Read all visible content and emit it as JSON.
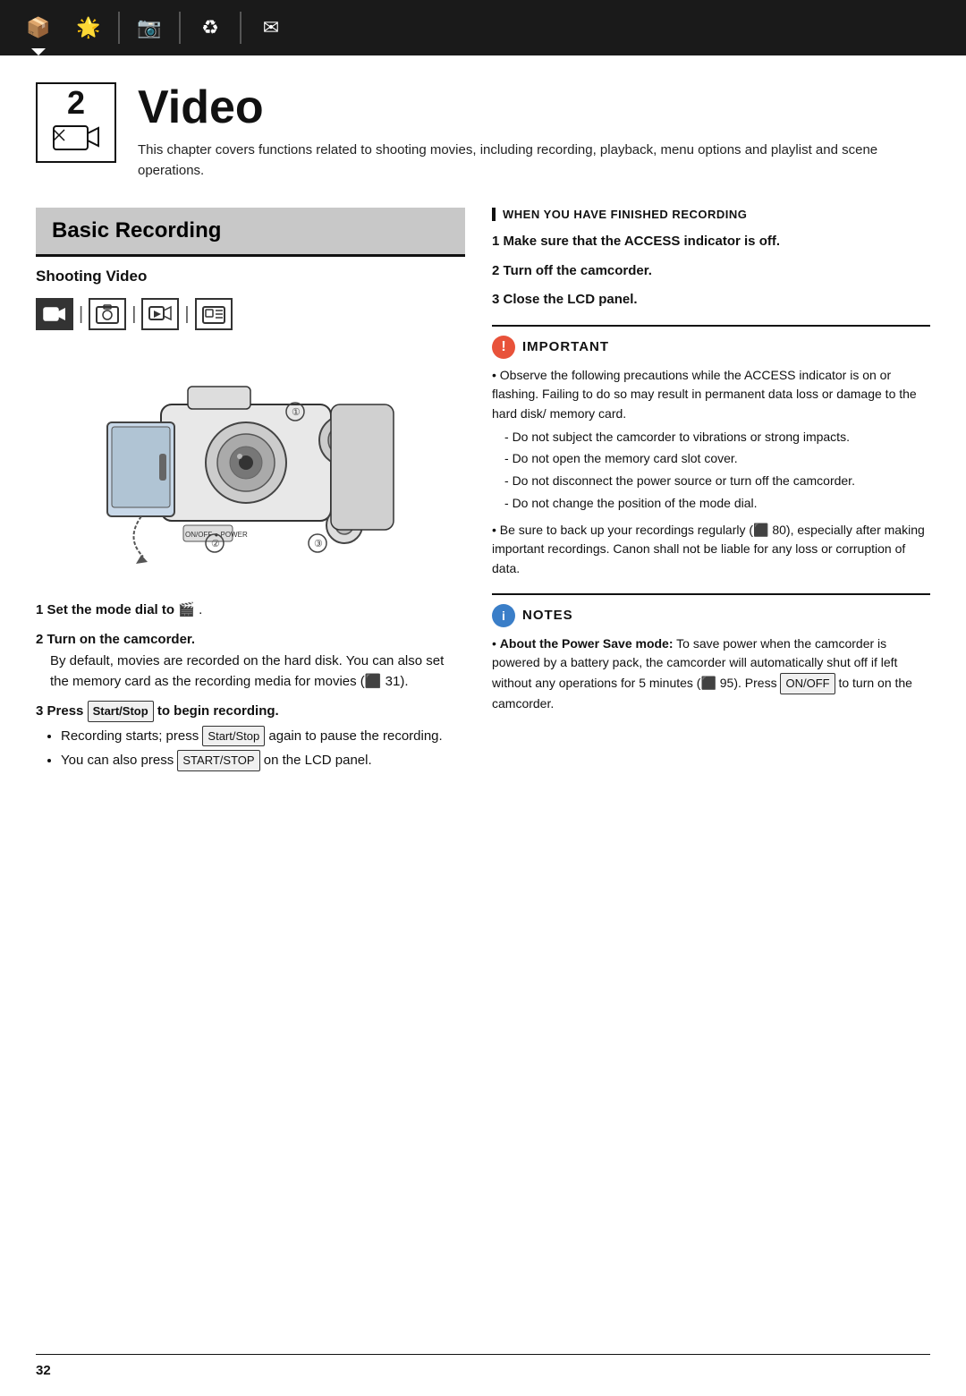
{
  "topbar": {
    "icons": [
      {
        "name": "box-icon",
        "symbol": "📦",
        "active": false
      },
      {
        "name": "star-icon",
        "symbol": "★",
        "active": true
      },
      {
        "name": "camera-icon",
        "symbol": "📷",
        "active": false
      },
      {
        "name": "recycle-icon",
        "symbol": "♻",
        "active": false
      },
      {
        "name": "envelope-icon",
        "symbol": "✉",
        "active": false
      }
    ]
  },
  "chapter": {
    "number": "2",
    "title": "Video",
    "description": "This chapter covers functions related to shooting movies, including recording, playback, menu options and playlist and scene operations."
  },
  "section": {
    "heading": "Basic Recording",
    "subsection": "Shooting Video"
  },
  "mode_icons": [
    "🎬",
    "📷",
    "📹",
    "▶"
  ],
  "steps_left": {
    "step1_label": "1",
    "step1_text": "Set the mode dial to",
    "step1_icon": "🎬",
    "step2_label": "2",
    "step2_text": "Turn on the camcorder.",
    "step2_body": "By default, movies are recorded on the hard disk. You can also set the memory card as the recording media for movies (⬛ 31).",
    "step3_label": "3",
    "step3_text": "Press",
    "step3_btn": "Start/Stop",
    "step3_text2": "to begin recording.",
    "bullets": [
      "Recording starts; press [Start/Stop] again to pause the recording.",
      "You can also press [START/STOP] on the LCD panel."
    ]
  },
  "when_finished": {
    "title": "When You Have Finished Recording",
    "step1": "Make sure that the ACCESS indicator is off.",
    "step2": "Turn off the camcorder.",
    "step3": "Close the LCD panel."
  },
  "important": {
    "label": "Important",
    "bullets": [
      "Observe the following precautions while the ACCESS indicator is on or flashing. Failing to do so may result in permanent data loss or damage to the hard disk/ memory card.",
      "Be sure to back up your recordings regularly (⬛ 80), especially after making important recordings. Canon shall not be liable for any loss or corruption of data."
    ],
    "sub_bullets": [
      "Do not subject the camcorder to vibrations or strong impacts.",
      "Do not open the memory card slot cover.",
      "Do not disconnect the power source or turn off the camcorder.",
      "Do not change the position of the mode dial."
    ]
  },
  "notes": {
    "label": "Notes",
    "text": "About the Power Save mode: To save power when the camcorder is powered by a battery pack, the camcorder will automatically shut off if left without any operations for 5 minutes (⬛ 95). Press [ON/OFF] to turn on the camcorder."
  },
  "page_number": "32"
}
